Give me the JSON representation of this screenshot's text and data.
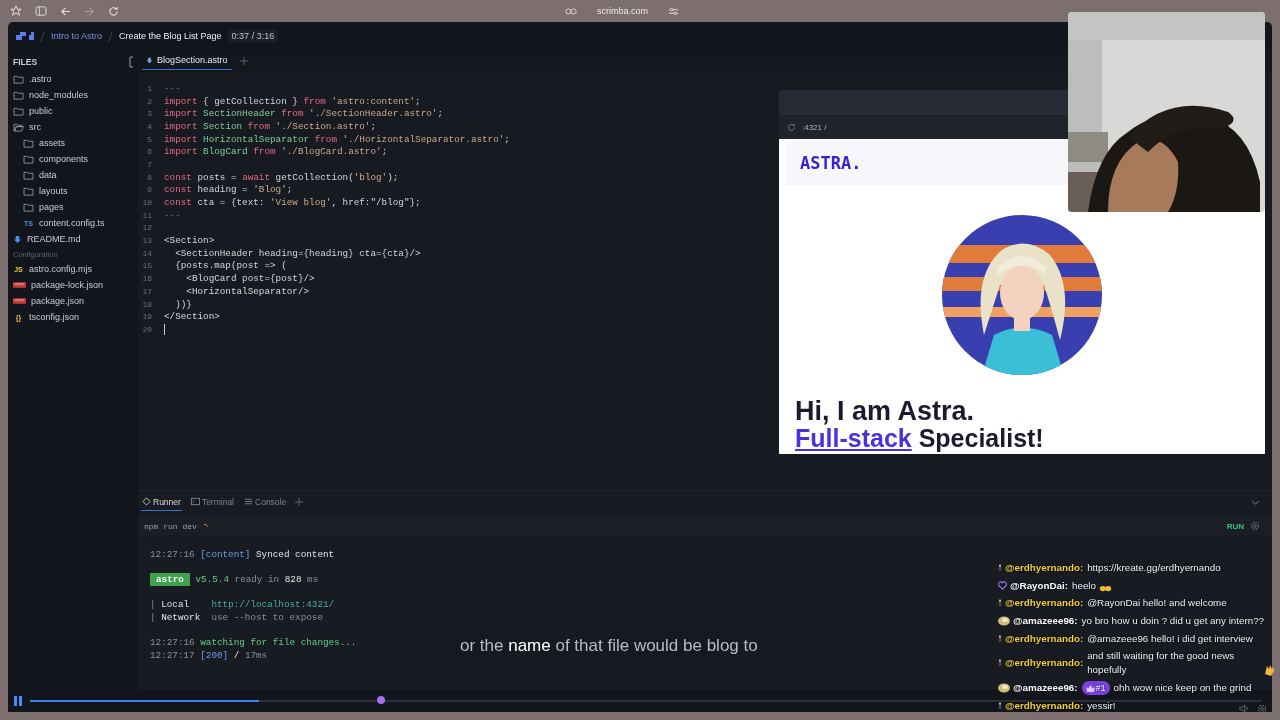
{
  "browser": {
    "url": "scrimba.com"
  },
  "header": {
    "course": "Intro to Astro",
    "lesson": "Create the Blog List Page",
    "time": "0:37 / 3:16"
  },
  "files": {
    "title": "FILES",
    "items": [
      {
        "name": ".astro",
        "kind": "folder",
        "expanded": false
      },
      {
        "name": "node_modules",
        "kind": "folder",
        "expanded": false
      },
      {
        "name": "public",
        "kind": "folder",
        "expanded": false
      },
      {
        "name": "src",
        "kind": "folder",
        "expanded": true,
        "children": [
          {
            "name": "assets",
            "kind": "folder",
            "expanded": false
          },
          {
            "name": "components",
            "kind": "folder",
            "expanded": false
          },
          {
            "name": "data",
            "kind": "folder",
            "expanded": false
          },
          {
            "name": "layouts",
            "kind": "folder",
            "expanded": false
          },
          {
            "name": "pages",
            "kind": "folder",
            "expanded": false
          },
          {
            "name": "content.config.ts",
            "kind": "ts",
            "badge": "TS"
          }
        ]
      },
      {
        "name": "README.md",
        "kind": "md"
      }
    ]
  },
  "config": {
    "title": "Configuration",
    "items": [
      {
        "name": "astro.config.mjs",
        "kind": "js",
        "badge": "JS"
      },
      {
        "name": "package-lock.json",
        "kind": "npm"
      },
      {
        "name": "package.json",
        "kind": "npm"
      },
      {
        "name": "tsconfig.json",
        "kind": "json",
        "badge": "{}"
      }
    ]
  },
  "editor": {
    "tabs": [
      {
        "label": "BlogSection.astro",
        "selected": true
      }
    ],
    "lines": [
      {
        "n": "1",
        "tokens": [
          {
            "kind": "comment",
            "text": "---"
          }
        ]
      },
      {
        "n": "2",
        "tokens": [
          {
            "kind": "keyword",
            "text": "import"
          },
          {
            "kind": "plain",
            "text": " { getCollection } "
          },
          {
            "kind": "keyword",
            "text": "from"
          },
          {
            "kind": "string",
            "text": " 'astro:content'"
          },
          {
            "kind": "plain",
            "text": ";"
          }
        ]
      },
      {
        "n": "3",
        "tokens": [
          {
            "kind": "keyword",
            "text": "import"
          },
          {
            "kind": "name",
            "text": " SectionHeader "
          },
          {
            "kind": "keyword",
            "text": "from"
          },
          {
            "kind": "string",
            "text": " './SectionHeader.astro'"
          },
          {
            "kind": "plain",
            "text": ";"
          }
        ]
      },
      {
        "n": "4",
        "tokens": [
          {
            "kind": "keyword",
            "text": "import"
          },
          {
            "kind": "name",
            "text": " Section "
          },
          {
            "kind": "keyword",
            "text": "from"
          },
          {
            "kind": "string",
            "text": " './Section.astro'"
          },
          {
            "kind": "plain",
            "text": ";"
          }
        ]
      },
      {
        "n": "5",
        "tokens": [
          {
            "kind": "keyword",
            "text": "import"
          },
          {
            "kind": "name",
            "text": " HorizontalSeparator "
          },
          {
            "kind": "keyword",
            "text": "from"
          },
          {
            "kind": "string",
            "text": " './HorizontalSeparator.astro'"
          },
          {
            "kind": "plain",
            "text": ";"
          }
        ]
      },
      {
        "n": "6",
        "tokens": [
          {
            "kind": "keyword",
            "text": "import"
          },
          {
            "kind": "name",
            "text": " BlogCard "
          },
          {
            "kind": "keyword",
            "text": "from"
          },
          {
            "kind": "string",
            "text": " './BlogCard.astro'"
          },
          {
            "kind": "plain",
            "text": ";"
          }
        ]
      },
      {
        "n": "7"
      },
      {
        "n": "8",
        "tokens": [
          {
            "kind": "keyword",
            "text": "const"
          },
          {
            "kind": "plain",
            "text": " posts = "
          },
          {
            "kind": "keyword",
            "text": "await"
          },
          {
            "kind": "plain",
            "text": " getCollection("
          },
          {
            "kind": "string",
            "text": "'blog'"
          },
          {
            "kind": "plain",
            "text": ");"
          }
        ]
      },
      {
        "n": "9",
        "tokens": [
          {
            "kind": "keyword",
            "text": "const"
          },
          {
            "kind": "plain",
            "text": " heading = "
          },
          {
            "kind": "string",
            "text": "'Blog'"
          },
          {
            "kind": "plain",
            "text": ";"
          }
        ]
      },
      {
        "n": "10",
        "tokens": [
          {
            "kind": "keyword",
            "text": "const"
          },
          {
            "kind": "plain",
            "text": " cta = {text: "
          },
          {
            "kind": "string",
            "text": "'View blog'"
          },
          {
            "kind": "plain",
            "text": ", href:\"/blog\"};"
          }
        ]
      },
      {
        "n": "11",
        "tokens": [
          {
            "kind": "comment",
            "text": "---"
          }
        ]
      },
      {
        "n": "12"
      },
      {
        "n": "13",
        "tokens": [
          {
            "kind": "tag",
            "text": "<Section>"
          }
        ]
      },
      {
        "n": "14",
        "tokens": [
          {
            "kind": "tag",
            "text": "  <SectionHeader"
          },
          {
            "kind": "plain",
            "text": " heading={heading} cta={cta}/>"
          }
        ]
      },
      {
        "n": "15",
        "tokens": [
          {
            "kind": "plain",
            "text": "  {posts.map(post => ("
          }
        ]
      },
      {
        "n": "16",
        "tokens": [
          {
            "kind": "tag",
            "text": "    <BlogCard"
          },
          {
            "kind": "plain",
            "text": " post={post}/>"
          }
        ]
      },
      {
        "n": "17",
        "tokens": [
          {
            "kind": "tag",
            "text": "    <HorizontalSeparator/>"
          }
        ]
      },
      {
        "n": "18",
        "tokens": [
          {
            "kind": "plain",
            "text": "  ))}"
          }
        ]
      },
      {
        "n": "19",
        "tokens": [
          {
            "kind": "tag",
            "text": "</Section>"
          }
        ]
      },
      {
        "n": "20",
        "caret": true
      }
    ]
  },
  "preview": {
    "address": ":4321 /",
    "logo": "ASTRA.",
    "heading": "Hi, I am Astra.",
    "accent": "Full-stack",
    "subheading": " Specialist!"
  },
  "runner": {
    "tabs": [
      {
        "label": "Runner",
        "kind": "runner",
        "selected": true
      },
      {
        "label": "Terminal",
        "kind": "terminal",
        "selected": false
      },
      {
        "label": "Console",
        "kind": "console",
        "selected": false
      }
    ],
    "command": "npm run dev",
    "run": "RUN",
    "blocks": [
      [
        [
          {
            "kind": "dim",
            "text": "12:27:16 "
          },
          {
            "kind": "blue",
            "text": "[content]"
          },
          {
            "kind": "white",
            "text": " Synced content"
          }
        ]
      ],
      [
        [
          {
            "kind": "badge",
            "text": "astro"
          },
          {
            "kind": "green",
            "text": " v5.5.4"
          },
          {
            "kind": "dim",
            "text": " ready in "
          },
          {
            "kind": "white",
            "text": "828"
          },
          {
            "kind": "dim",
            "text": " ms"
          }
        ]
      ],
      [
        [
          {
            "kind": "dim",
            "text": "| "
          },
          {
            "kind": "white",
            "text": "Local    "
          },
          {
            "kind": "teal",
            "text": "http://localhost:4321/"
          }
        ],
        [
          {
            "kind": "dim",
            "text": "| "
          },
          {
            "kind": "white",
            "text": "Network  "
          },
          {
            "kind": "dim",
            "text": "use --host to expose"
          }
        ]
      ],
      [
        [
          {
            "kind": "dim",
            "text": "12:27:16 "
          },
          {
            "kind": "green",
            "text": "watching for file changes..."
          }
        ],
        [
          {
            "kind": "dim",
            "text": "12:27:17 "
          },
          {
            "kind": "blue",
            "text": "[200]"
          },
          {
            "kind": "white",
            "text": " / "
          },
          {
            "kind": "dim",
            "text": "17ms"
          }
        ]
      ]
    ]
  },
  "subtitle": "or the **name** of that file would be blog to",
  "chat": [
    {
      "user": "@erdhyernando:",
      "color": "#f2cf3b",
      "kind": "figure",
      "text": "https://kreate.gg/erdhyernando"
    },
    {
      "user": "@RayonDai:",
      "color": "#ffffff",
      "kind": "heart",
      "text": "heelo",
      "emote": {
        "kind": "hands"
      }
    },
    {
      "user": "@erdhyernando:",
      "color": "#f2cf3b",
      "kind": "figure",
      "text": "@RayonDai hello! and welcome"
    },
    {
      "user": "@amazeee96:",
      "color": "#ffffff",
      "kind": "cookie",
      "text": "yo bro how u doin ? did u get any intern??"
    },
    {
      "user": "@erdhyernando:",
      "color": "#f2cf3b",
      "kind": "figure",
      "text": "@amazeee96 hello! i did get interview"
    },
    {
      "user": "@erdhyernando:",
      "color": "#f2cf3b",
      "kind": "figure",
      "text": "and still waiting for the good news hopefully",
      "emote": {
        "kind": "clap"
      }
    },
    {
      "user": "@amazeee96:",
      "color": "#ffffff",
      "kind": "cookie",
      "badge": "#1",
      "text": "ohh wow nice keep on the grind"
    },
    {
      "user": "@erdhyernando:",
      "color": "#f2cf3b",
      "kind": "figure",
      "text": "yessir!"
    }
  ],
  "player": {
    "playing": true,
    "level": 0.186
  }
}
